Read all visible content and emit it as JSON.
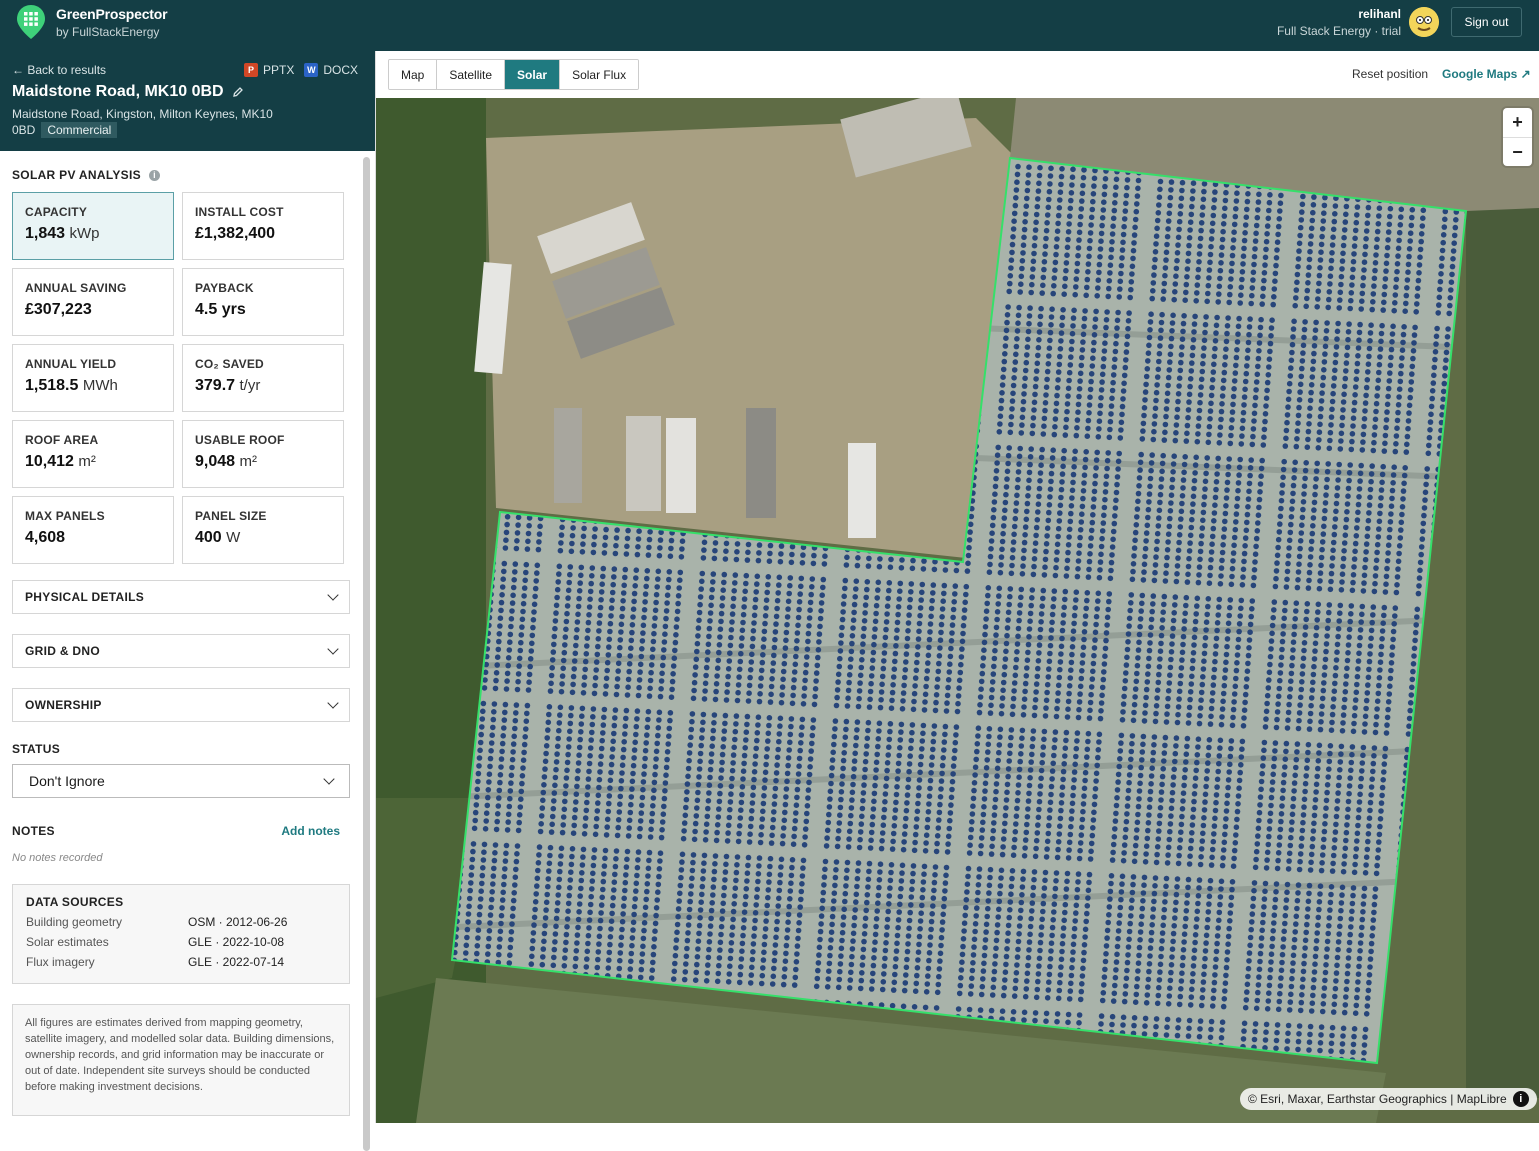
{
  "header": {
    "brand_name": "GreenProspector",
    "brand_sub": "by FullStackEnergy",
    "user_name": "relihanl",
    "user_org": "Full Stack Energy · trial",
    "signout_label": "Sign out"
  },
  "sidebar": {
    "back_label": "← Back to results",
    "export_pptx": "PPTX",
    "export_docx": "DOCX",
    "title": "Maidstone Road, MK10 0BD",
    "address": "Maidstone Road, Kingston, Milton Keynes, MK10 0BD",
    "type_badge": "Commercial",
    "solar_heading": "SOLAR PV ANALYSIS",
    "cards": [
      {
        "label": "CAPACITY",
        "value": "1,843",
        "unit": "kWp"
      },
      {
        "label": "INSTALL COST",
        "value": "£1,382,400",
        "unit": ""
      },
      {
        "label": "ANNUAL SAVING",
        "value": "£307,223",
        "unit": ""
      },
      {
        "label": "PAYBACK",
        "value": "4.5 yrs",
        "unit": ""
      },
      {
        "label": "ANNUAL YIELD",
        "value": "1,518.5",
        "unit": "MWh"
      },
      {
        "label": "CO₂ SAVED",
        "value": "379.7",
        "unit": "t/yr"
      },
      {
        "label": "ROOF AREA",
        "value": "10,412",
        "unit": "m²"
      },
      {
        "label": "USABLE ROOF",
        "value": "9,048",
        "unit": "m²"
      },
      {
        "label": "MAX PANELS",
        "value": "4,608",
        "unit": ""
      },
      {
        "label": "PANEL SIZE",
        "value": "400",
        "unit": "W"
      }
    ],
    "accordions": [
      "PHYSICAL DETAILS",
      "GRID & DNO",
      "OWNERSHIP"
    ],
    "status_label": "STATUS",
    "status_value": "Don't Ignore",
    "notes_label": "NOTES",
    "add_notes": "Add notes",
    "no_notes": "No notes recorded",
    "data_sources_title": "DATA SOURCES",
    "data_sources": [
      {
        "key": "Building geometry",
        "value": "OSM · 2012-06-26"
      },
      {
        "key": "Solar estimates",
        "value": "GLE · 2022-10-08"
      },
      {
        "key": "Flux imagery",
        "value": "GLE · 2022-07-14"
      }
    ],
    "disclaimer": "All figures are estimates derived from mapping geometry, satellite imagery, and modelled solar data. Building dimensions, ownership records, and grid information may be inaccurate or out of date. Independent site surveys should be conducted before making investment decisions."
  },
  "map": {
    "tabs": [
      "Map",
      "Satellite",
      "Solar",
      "Solar Flux"
    ],
    "active_tab": "Solar",
    "reset_label": "Reset position",
    "gmaps_label": "Google Maps ↗",
    "zoom_in": "+",
    "zoom_out": "−",
    "attribution": "© Esri, Maxar, Earthstar Geographics | MapLibre",
    "outline_color": "#35e06a",
    "panel_color": "#27457a"
  },
  "colors": {
    "header_bg": "#143e45",
    "accent": "#1f7a80"
  }
}
